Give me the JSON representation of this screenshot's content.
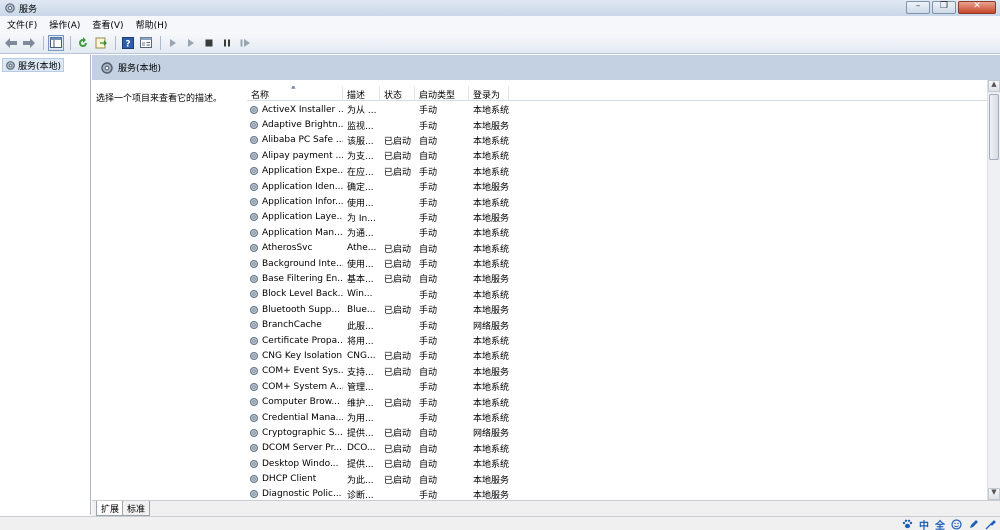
{
  "window": {
    "title": "服务"
  },
  "menu": [
    "文件(F)",
    "操作(A)",
    "查看(V)",
    "帮助(H)"
  ],
  "toolbar": {
    "icons": [
      "back-arrow-icon",
      "forward-arrow-icon",
      "console-tree-icon",
      "refresh-icon",
      "export-icon",
      "help-icon",
      "properties-icon",
      "start-icon",
      "start-alt-icon",
      "stop-icon",
      "pause-icon",
      "restart-icon"
    ]
  },
  "tree": {
    "item": "服务(本地)"
  },
  "banner": {
    "title": "服务(本地)"
  },
  "description": {
    "prompt": "选择一个项目来查看它的描述。"
  },
  "columns": [
    "名称",
    "描述",
    "状态",
    "启动类型",
    "登录为"
  ],
  "services": [
    {
      "name": "ActiveX Installer ...",
      "desc": "为从 ...",
      "status": "",
      "startup": "手动",
      "logon": "本地系统"
    },
    {
      "name": "Adaptive Brightn...",
      "desc": "监视...",
      "status": "",
      "startup": "手动",
      "logon": "本地服务"
    },
    {
      "name": "Alibaba PC Safe ...",
      "desc": "该服...",
      "status": "已启动",
      "startup": "自动",
      "logon": "本地系统"
    },
    {
      "name": "Alipay payment ...",
      "desc": "为支...",
      "status": "已启动",
      "startup": "自动",
      "logon": "本地系统"
    },
    {
      "name": "Application Expe...",
      "desc": "在应...",
      "status": "已启动",
      "startup": "手动",
      "logon": "本地系统"
    },
    {
      "name": "Application Iden...",
      "desc": "确定...",
      "status": "",
      "startup": "手动",
      "logon": "本地服务"
    },
    {
      "name": "Application Infor...",
      "desc": "使用...",
      "status": "",
      "startup": "手动",
      "logon": "本地系统"
    },
    {
      "name": "Application Laye...",
      "desc": "为 In...",
      "status": "",
      "startup": "手动",
      "logon": "本地服务"
    },
    {
      "name": "Application Man...",
      "desc": "为通...",
      "status": "",
      "startup": "手动",
      "logon": "本地系统"
    },
    {
      "name": "AtherosSvc",
      "desc": "Athe...",
      "status": "已启动",
      "startup": "自动",
      "logon": "本地系统"
    },
    {
      "name": "Background Inte...",
      "desc": "使用...",
      "status": "已启动",
      "startup": "手动",
      "logon": "本地系统"
    },
    {
      "name": "Base Filtering En...",
      "desc": "基本...",
      "status": "已启动",
      "startup": "自动",
      "logon": "本地服务"
    },
    {
      "name": "Block Level Back...",
      "desc": "Win...",
      "status": "",
      "startup": "手动",
      "logon": "本地系统"
    },
    {
      "name": "Bluetooth Supp...",
      "desc": "Blue...",
      "status": "已启动",
      "startup": "手动",
      "logon": "本地服务"
    },
    {
      "name": "BranchCache",
      "desc": "此服...",
      "status": "",
      "startup": "手动",
      "logon": "网络服务"
    },
    {
      "name": "Certificate Propa...",
      "desc": "将用...",
      "status": "",
      "startup": "手动",
      "logon": "本地系统"
    },
    {
      "name": "CNG Key Isolation",
      "desc": "CNG...",
      "status": "已启动",
      "startup": "手动",
      "logon": "本地系统"
    },
    {
      "name": "COM+ Event Sys...",
      "desc": "支持...",
      "status": "已启动",
      "startup": "自动",
      "logon": "本地服务"
    },
    {
      "name": "COM+ System A...",
      "desc": "管理...",
      "status": "",
      "startup": "手动",
      "logon": "本地系统"
    },
    {
      "name": "Computer Brow...",
      "desc": "维护...",
      "status": "已启动",
      "startup": "手动",
      "logon": "本地系统"
    },
    {
      "name": "Credential Mana...",
      "desc": "为用...",
      "status": "",
      "startup": "手动",
      "logon": "本地系统"
    },
    {
      "name": "Cryptographic S...",
      "desc": "提供...",
      "status": "已启动",
      "startup": "自动",
      "logon": "网络服务"
    },
    {
      "name": "DCOM Server Pr...",
      "desc": "DCO...",
      "status": "已启动",
      "startup": "自动",
      "logon": "本地系统"
    },
    {
      "name": "Desktop Windo...",
      "desc": "提供...",
      "status": "已启动",
      "startup": "自动",
      "logon": "本地系统"
    },
    {
      "name": "DHCP Client",
      "desc": "为此...",
      "status": "已启动",
      "startup": "自动",
      "logon": "本地服务"
    },
    {
      "name": "Diagnostic Polic...",
      "desc": "诊断...",
      "status": "",
      "startup": "手动",
      "logon": "本地服务"
    }
  ],
  "tabs": [
    "扩展",
    "标准"
  ],
  "ime": {
    "lang": "中",
    "width": "全"
  },
  "colors": {
    "banner": "#c3d1e3",
    "titlebar": "#c9d7e8",
    "close": "#c6462c",
    "accent": "#1f5fb5"
  }
}
